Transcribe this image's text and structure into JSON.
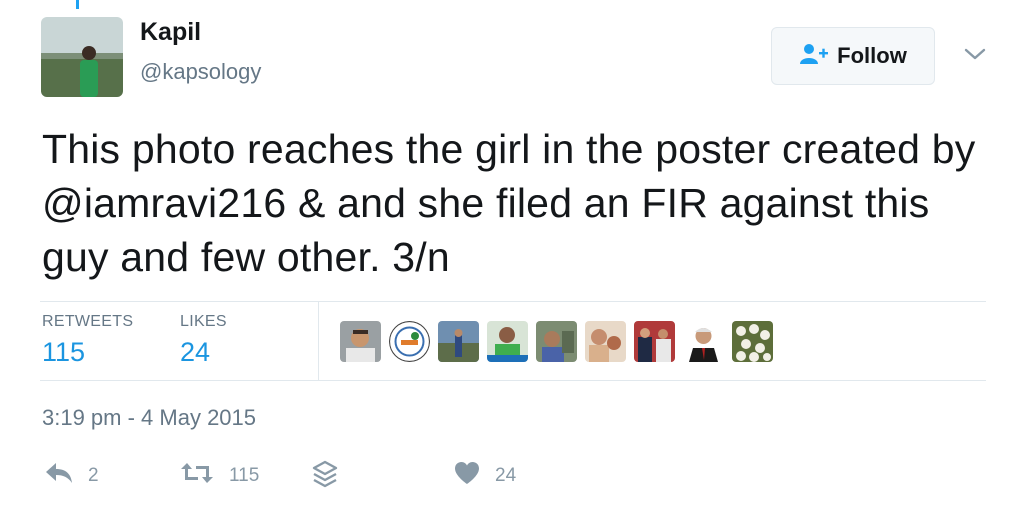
{
  "user": {
    "name": "Kapil",
    "handle": "@kapsology"
  },
  "follow": {
    "label": "Follow"
  },
  "tweet": {
    "text": "This photo reaches the girl in the poster created by @iamravi216 & and she filed an FIR against this guy and few other. 3/n"
  },
  "stats": {
    "retweets_label": "RETWEETS",
    "retweets_value": "115",
    "likes_label": "LIKES",
    "likes_value": "24"
  },
  "timestamp": "3:19 pm - 4 May 2015",
  "actions": {
    "reply_count": "2",
    "retweet_count": "115",
    "like_count": "24"
  },
  "icons": {
    "follow": "add-user-icon",
    "caret": "chevron-down-icon",
    "reply": "reply-icon",
    "retweet": "retweet-icon",
    "stack": "stack-icon",
    "like": "heart-icon"
  },
  "colors": {
    "accent": "#1da1f2",
    "link": "#1b95e0",
    "secondary_text": "#657786",
    "action_icon": "#8899a6"
  }
}
